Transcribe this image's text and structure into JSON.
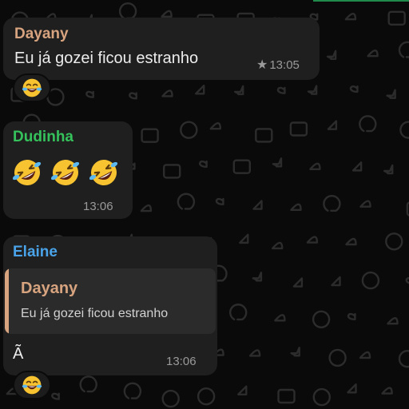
{
  "colors": {
    "background": "#0a0a0a",
    "bubble": "#1f1f1f",
    "quote_background": "#2b2b2b",
    "sender_dayany": "#d8a47f",
    "sender_dudinha": "#35c15b",
    "sender_elaine": "#4aa3e8",
    "timestamp": "#9a9a9a",
    "text": "#ececec"
  },
  "messages": [
    {
      "sender": "Dayany",
      "text": "Eu já gozei ficou estranho",
      "time": "13:05",
      "starred": true,
      "reaction": "face-with-tears-of-joy-icon"
    },
    {
      "sender": "Dudinha",
      "emojis": [
        "rolling-on-the-floor-laughing-icon",
        "rolling-on-the-floor-laughing-icon",
        "rolling-on-the-floor-laughing-icon"
      ],
      "time": "13:06"
    },
    {
      "sender": "Elaine",
      "quote": {
        "sender": "Dayany",
        "text": "Eu já gozei ficou estranho"
      },
      "text": "Ã",
      "time": "13:06",
      "reaction": "face-with-tears-of-joy-icon"
    }
  ]
}
